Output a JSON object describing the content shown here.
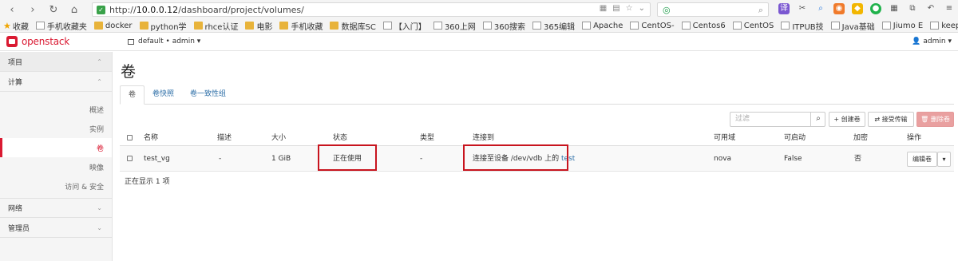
{
  "browser": {
    "url_prefix": "http://",
    "url_host": "10.0.0.12",
    "url_path": "/dashboard/project/volumes/",
    "search_placeholder": "",
    "bookmarks": [
      {
        "label": "收藏",
        "kind": "star"
      },
      {
        "label": "手机收藏夹",
        "kind": "page"
      },
      {
        "label": "docker",
        "kind": "folder"
      },
      {
        "label": "python学",
        "kind": "folder"
      },
      {
        "label": "rhce认证",
        "kind": "folder"
      },
      {
        "label": "电影",
        "kind": "folder"
      },
      {
        "label": "手机收藏",
        "kind": "folder"
      },
      {
        "label": "数据库SC",
        "kind": "folder"
      },
      {
        "label": "【入门】",
        "kind": "page"
      },
      {
        "label": "360上网",
        "kind": "page"
      },
      {
        "label": "360搜索",
        "kind": "page"
      },
      {
        "label": "365编辑",
        "kind": "page"
      },
      {
        "label": "Apache",
        "kind": "page"
      },
      {
        "label": "CentOS-",
        "kind": "page"
      },
      {
        "label": "Centos6",
        "kind": "page"
      },
      {
        "label": "CentOS",
        "kind": "page"
      },
      {
        "label": "ITPUB技",
        "kind": "page"
      },
      {
        "label": "Java基础",
        "kind": "page"
      },
      {
        "label": "Jiumo E",
        "kind": "page"
      },
      {
        "label": "keepaliv",
        "kind": "page"
      },
      {
        "label": "»",
        "kind": "none"
      }
    ]
  },
  "header": {
    "logo_text": "openstack",
    "project_selector": "default • admin ▾",
    "user_menu": "👤 admin ▾"
  },
  "sidebar": {
    "sections": [
      {
        "label": "项目",
        "chevron": "⌃"
      },
      {
        "label": "计算",
        "chevron": "⌃"
      }
    ],
    "compute_items": [
      {
        "label": "概述"
      },
      {
        "label": "实例"
      },
      {
        "label": "卷"
      },
      {
        "label": "映像"
      },
      {
        "label": "访问 & 安全"
      }
    ],
    "bottom_sections": [
      {
        "label": "网络",
        "chevron": "⌄"
      },
      {
        "label": "管理员",
        "chevron": "⌄"
      }
    ]
  },
  "main": {
    "title": "卷",
    "tabs": [
      {
        "label": "卷"
      },
      {
        "label": "卷快照"
      },
      {
        "label": "卷一致性组"
      }
    ],
    "filter_placeholder": "过滤",
    "buttons": {
      "create": "+ 创建卷",
      "accept_transfer": "⇄ 接受传输",
      "delete": "🗑 删除卷"
    },
    "table": {
      "columns": [
        "名称",
        "描述",
        "大小",
        "状态",
        "类型",
        "连接到",
        "可用域",
        "可启动",
        "加密",
        "操作"
      ],
      "rows": [
        {
          "name": "test_vg",
          "description": "-",
          "size": "1 GiB",
          "status": "正在使用",
          "type": "-",
          "attached_prefix": "连接至设备 /dev/vdb 上的",
          "attached_instance": "test",
          "zone": "nova",
          "bootable": "False",
          "encrypted": "否",
          "action": "编辑卷",
          "action_toggle": "▾"
        }
      ]
    },
    "footer": "正在显示 1 项"
  },
  "colors": {
    "accent_red": "#da1a32",
    "link_blue": "#2f70a8",
    "highlight_border": "#c8141e"
  }
}
